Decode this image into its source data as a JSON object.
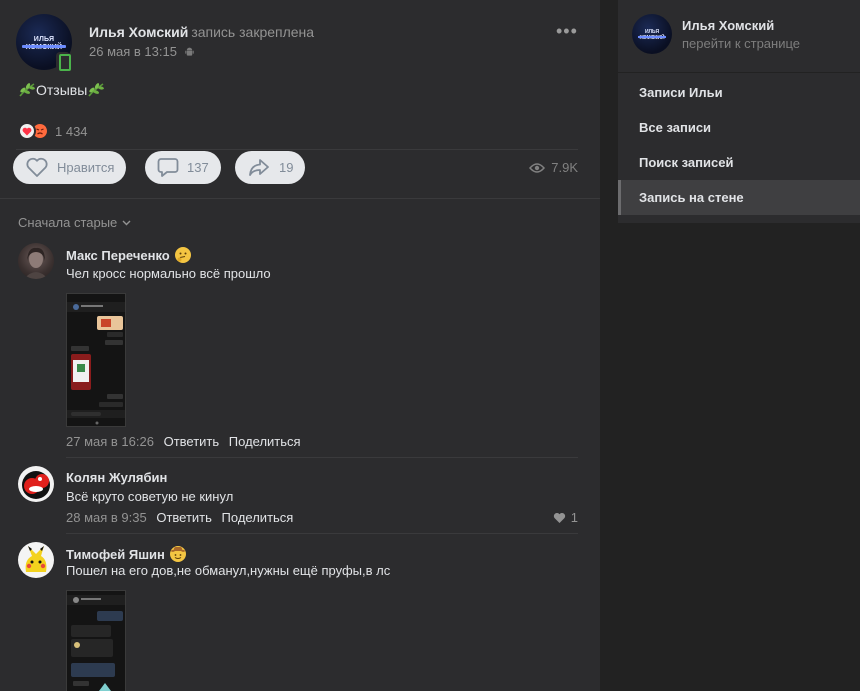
{
  "post": {
    "author": "Илья Хомский",
    "pinned_label": "запись закреплена",
    "date": "26 мая в 13:15",
    "avatar_text": "ИЛЬЯ ХОМСКИЙ",
    "text": "Отзывы",
    "reactions_count": "1 434",
    "like_label": "Нравится",
    "comments_count": "137",
    "shares_count": "19",
    "views": "7.9K",
    "icons": [
      "heart-icon",
      "comment-icon",
      "share-icon",
      "eye-icon",
      "android-icon",
      "more-icon"
    ]
  },
  "comments_section": {
    "sort_label": "Сначала старые"
  },
  "comments": [
    {
      "name": "Макс Переченко",
      "text": "Чел кросс нормально всё прошло",
      "date": "27 мая в 16:26",
      "reply": "Ответить",
      "share": "Поделиться"
    },
    {
      "name": "Колян Жулябин",
      "text": "Всё круто советую не кинул",
      "date": "28 мая в 9:35",
      "reply": "Ответить",
      "share": "Поделиться",
      "likes": "1"
    },
    {
      "name": "Тимофей Яшин",
      "text": "Пошел на его дов,не обманул,нужны ещё пруфы,в лс"
    }
  ],
  "sidebar": {
    "profile_name": "Илья Хомский",
    "profile_link": "перейти к странице",
    "avatar_text": "ИЛЬЯ ХОМСКИЙ",
    "items": [
      {
        "label": "Записи Ильи"
      },
      {
        "label": "Все записи"
      },
      {
        "label": "Поиск записей"
      },
      {
        "label": "Запись на стене"
      }
    ]
  },
  "colors": {
    "background": "#222222",
    "card": "#2c2c2e",
    "text": "#e1e3e6",
    "muted": "#939393",
    "button_bg": "#e6e8eb",
    "online_green": "#4bb34b"
  }
}
